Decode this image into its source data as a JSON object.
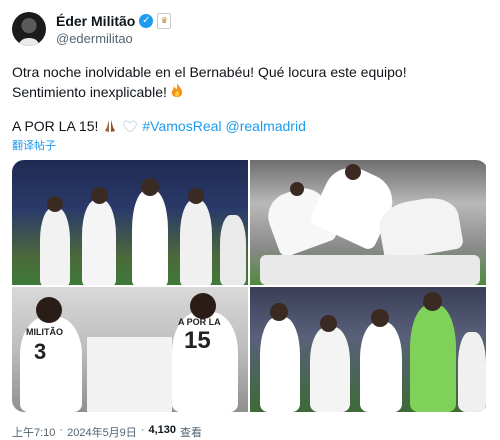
{
  "author": {
    "display_name": "Éder Militão",
    "handle": "@edermilitao",
    "badge_icon": "real-madrid-crest-icon",
    "verified_icon": "verified-check-icon"
  },
  "tweet": {
    "line1": "Otra noche inolvidable en el Bernabéu! Qué locura este equipo!",
    "line2": "Sentimiento inexplicable!",
    "line3_text": "A POR LA 15!",
    "hashtag": "#VamosReal",
    "mention": "@realmadrid",
    "translate_label": "翻译帖子"
  },
  "media": {
    "photos": [
      {
        "name": "photo-stadium-celebration"
      },
      {
        "name": "photo-player-pile"
      },
      {
        "name": "photo-locker-room"
      },
      {
        "name": "photo-team-applause"
      }
    ],
    "jersey_text": "A POR LA",
    "jersey_number": "15",
    "shirt_name_left": "MILITÃO",
    "shirt_number_left": "3"
  },
  "footer": {
    "time": "上午7:10",
    "sep": "·",
    "date": "2024年5月9日",
    "sep2": "·",
    "views_count": "4,130",
    "views_label": "查看"
  },
  "colors": {
    "link": "#1d9bf0",
    "secondary_text": "#536471",
    "primary_text": "#0f1419"
  }
}
